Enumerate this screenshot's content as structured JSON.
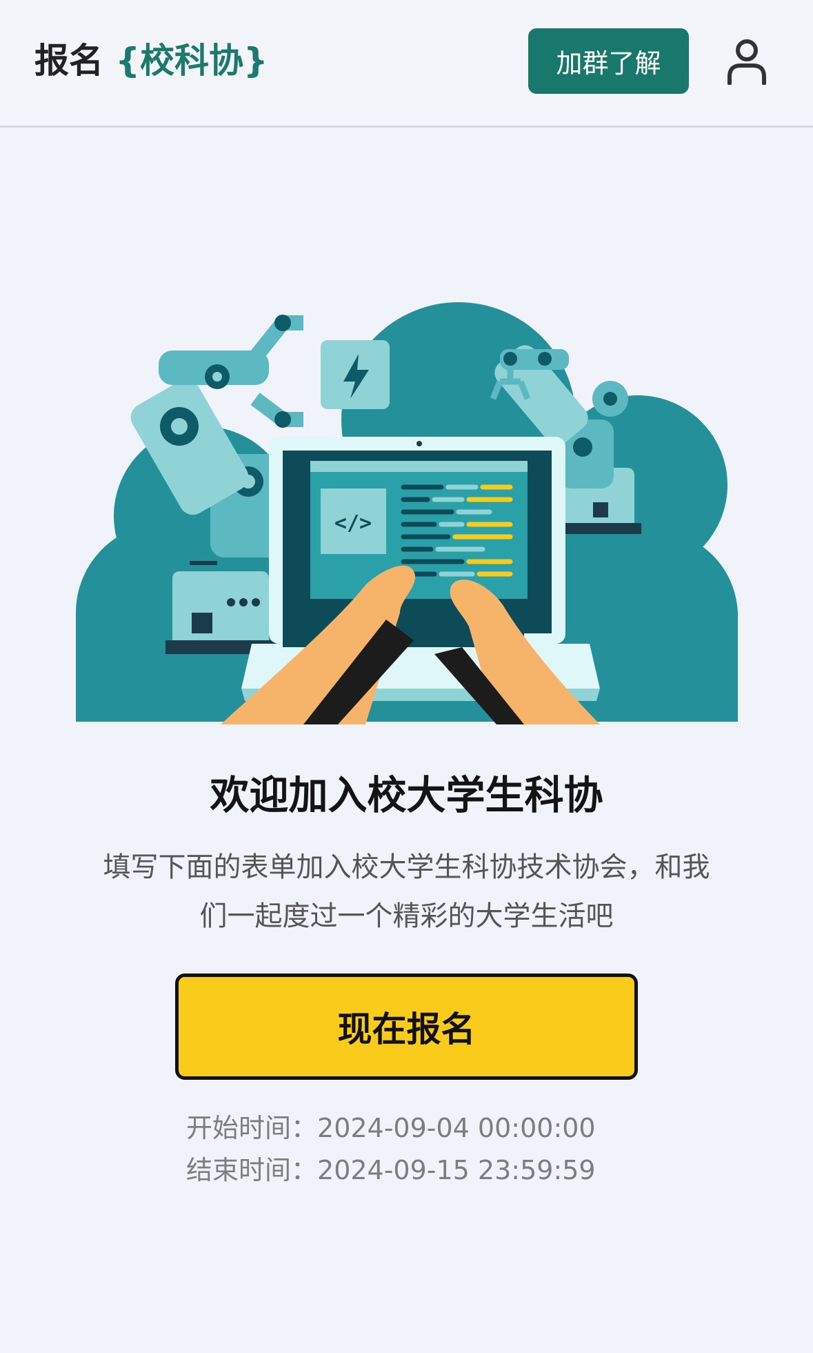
{
  "header": {
    "brand_prefix": "报名",
    "brand_accent": "{校科协}",
    "join_button": "加群了解",
    "user_icon": "user-icon"
  },
  "main": {
    "hero_image": "robots-laptop-illustration",
    "title": "欢迎加入校大学生科协",
    "description": "填写下面的表单加入校大学生科协技术协会，和我们一起度过一个精彩的大学生活吧",
    "signup_button": "现在报名",
    "start_label": "开始时间：",
    "start_value": "2024-09-04 00:00:00",
    "end_label": "结束时间：",
    "end_value": "2024-09-15 23:59:59"
  },
  "colors": {
    "accent_green": "#17786b",
    "button_yellow": "#f9cb1b",
    "background": "#f1f3fb"
  }
}
